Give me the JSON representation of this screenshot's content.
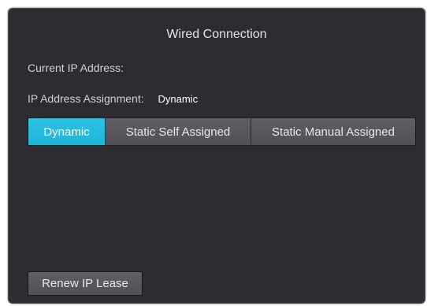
{
  "panel": {
    "title": "Wired Connection",
    "current_ip_label": "Current IP Address:",
    "current_ip_value": "",
    "assignment_label": "IP Address Assignment:",
    "assignment_value": "Dynamic"
  },
  "assignment_modes": {
    "options": [
      "Dynamic",
      "Static Self Assigned",
      "Static Manual Assigned"
    ],
    "selected": "Dynamic"
  },
  "actions": {
    "renew_label": "Renew IP Lease"
  },
  "colors": {
    "panel_bg": "#2c2d30",
    "accent": "#2cc3e6",
    "button_bg": "#58595d"
  }
}
